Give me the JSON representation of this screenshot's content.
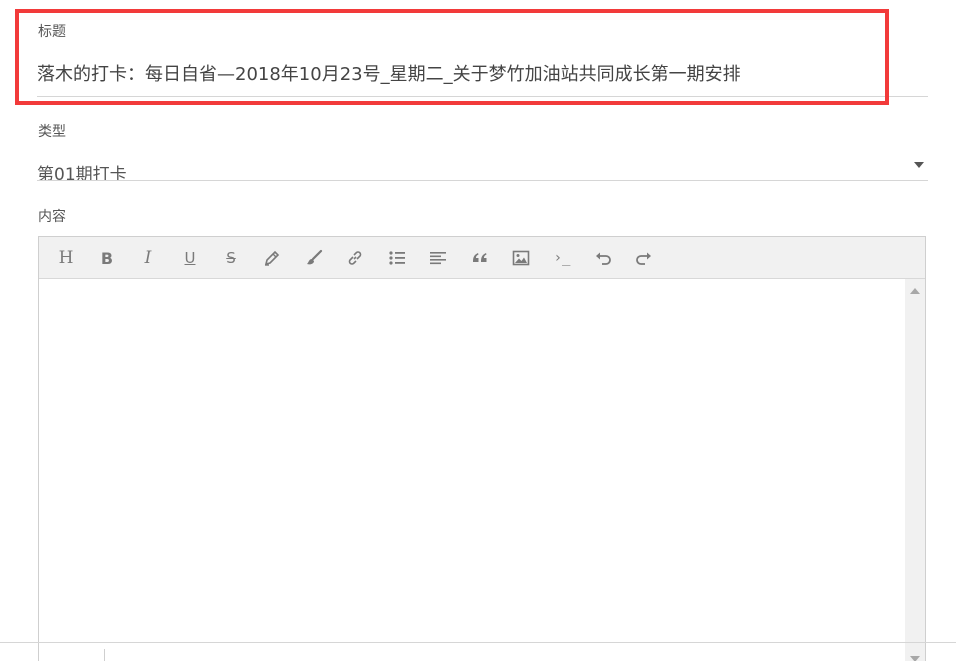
{
  "form": {
    "title_label": "标题",
    "title_value": "落木的打卡：每日自省—2018年10月23号_星期二_关于梦竹加油站共同成长第一期安排",
    "type_label": "类型",
    "type_value": "第01期打卡",
    "content_label": "内容"
  },
  "toolbar": {
    "heading": "H",
    "bold": "B",
    "italic": "I",
    "underline": "U",
    "strike": "S",
    "code": "›_"
  },
  "colors": {
    "highlight": "#f23a3a",
    "toolbar_bg": "#f1f1f1",
    "icon": "#7a7a7a"
  }
}
